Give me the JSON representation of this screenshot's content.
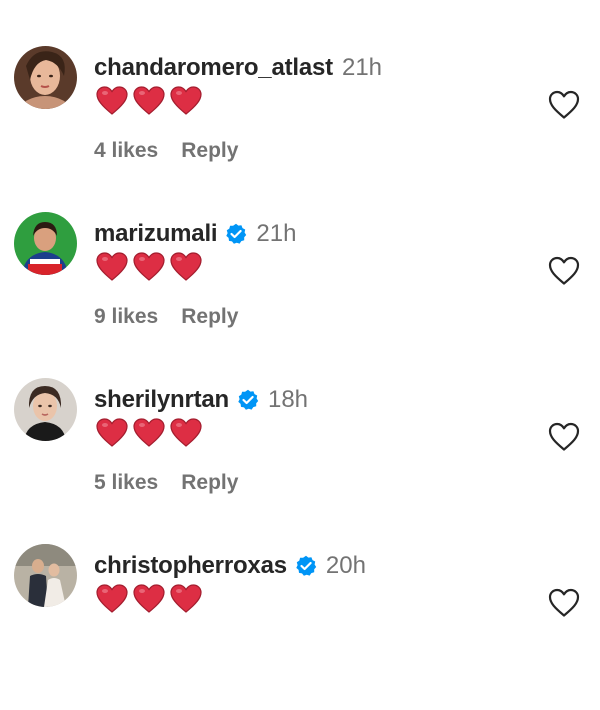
{
  "comments": [
    {
      "username": "chandaromero_atlast",
      "verified": false,
      "time": "21h",
      "text": "❤️❤️❤️",
      "likes": "4 likes",
      "reply": "Reply"
    },
    {
      "username": "marizumali",
      "verified": true,
      "time": "21h",
      "text": "❤️❤️❤️",
      "likes": "9 likes",
      "reply": "Reply"
    },
    {
      "username": "sherilynrtan",
      "verified": true,
      "time": "18h",
      "text": "❤️❤️❤️",
      "likes": "5 likes",
      "reply": "Reply"
    },
    {
      "username": "christopherroxas",
      "verified": true,
      "time": "20h",
      "text": "❤️❤️❤️",
      "likes": "",
      "reply": ""
    }
  ],
  "colors": {
    "verified_badge": "#0095f6",
    "heart_emoji": "#dd2e44",
    "username": "#262626",
    "secondary_text": "#737373"
  },
  "icons": {
    "like": "heart-outline-icon",
    "verified": "verified-badge-icon"
  }
}
